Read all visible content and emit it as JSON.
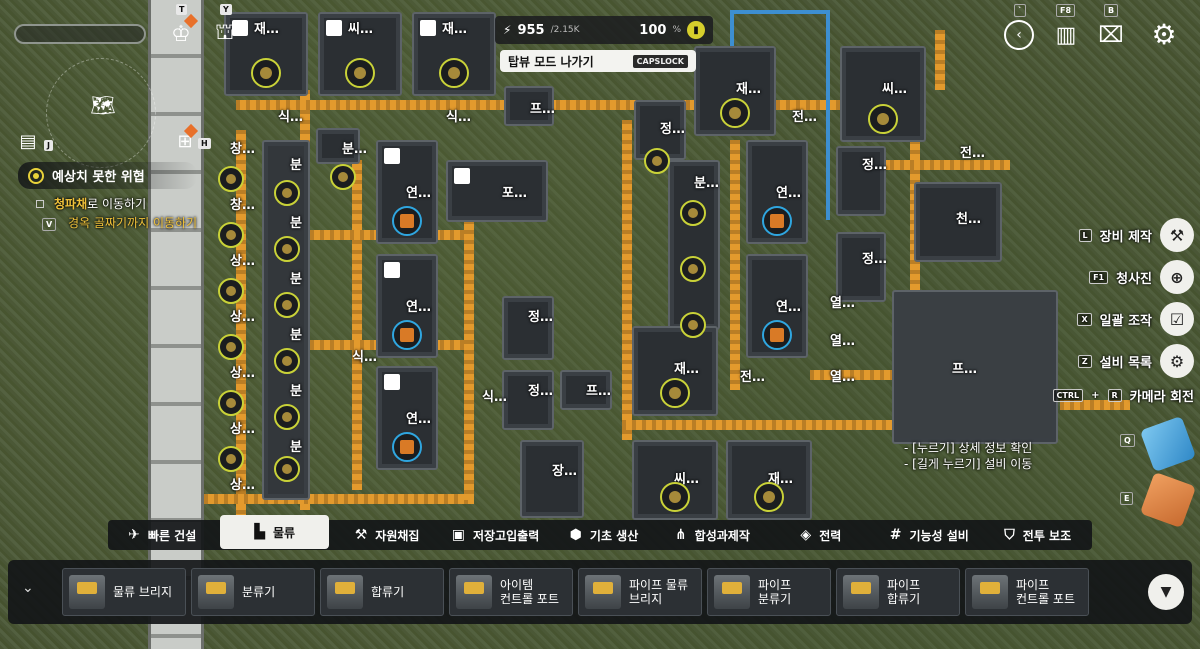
{
  "status": {
    "power": "955",
    "power_max": "/2.15K",
    "percent": "100",
    "percent_unit": "%"
  },
  "mode_button": {
    "label": "탑뷰 모드 나가기",
    "key": "CAPSLOCK"
  },
  "hud_keys": {
    "tree": "T",
    "tower": "Y",
    "info": "J",
    "bp": "H",
    "back": "`",
    "f8": "F8",
    "bag": "B"
  },
  "quest": {
    "title": "예상치 못한 위협",
    "step_highlight": "청파채",
    "step_rest": "로 이동하기",
    "step_key": "V",
    "substep": "경옥 골짜기까지 이동하기"
  },
  "right_menu": [
    {
      "key": "L",
      "label": "장비 제작",
      "icon": "equipment-craft-icon"
    },
    {
      "key": "F1",
      "label": "청사진",
      "icon": "blueprint-icon"
    },
    {
      "key": "X",
      "label": "일괄 조작",
      "icon": "batch-operation-icon"
    },
    {
      "key": "Z",
      "label": "설비 목록",
      "icon": "facility-list-icon"
    }
  ],
  "camera": {
    "key1": "CTRL",
    "key2": "R",
    "label": "카메라 회전",
    "q": "Q",
    "e": "E"
  },
  "hints": [
    "- [누르기] 상세 정보 확인",
    "- [길게 누르기] 설비 이동"
  ],
  "categories": [
    {
      "label": "빠른 건설",
      "icon": "quick-build-icon",
      "active": false
    },
    {
      "label": "물류",
      "icon": "logistics-icon",
      "active": true
    },
    {
      "label": "자원채집",
      "icon": "resource-gather-icon",
      "active": false
    },
    {
      "label": "저장고입출력",
      "icon": "storage-io-icon",
      "active": false
    },
    {
      "label": "기초 생산",
      "icon": "basic-production-icon",
      "active": false
    },
    {
      "label": "합성과제작",
      "icon": "synthesis-icon",
      "active": false
    },
    {
      "label": "전력",
      "icon": "power-icon",
      "active": false
    },
    {
      "label": "기능성 설비",
      "icon": "function-facility-icon",
      "active": false
    },
    {
      "label": "전투 보조",
      "icon": "combat-support-icon",
      "active": false
    }
  ],
  "items": [
    {
      "l1": "물류 브리지",
      "l2": ""
    },
    {
      "l1": "분류기",
      "l2": ""
    },
    {
      "l1": "합류기",
      "l2": ""
    },
    {
      "l1": "아이템",
      "l2": "컨트롤 포트"
    },
    {
      "l1": "파이프 물류",
      "l2": "브리지"
    },
    {
      "l1": "파이프",
      "l2": "분류기"
    },
    {
      "l1": "파이프",
      "l2": "합류기"
    },
    {
      "l1": "파이프",
      "l2": "컨트롤 포트"
    }
  ],
  "world_labels": {
    "jae": "재…",
    "ssi": "씨…",
    "sik": "식…",
    "bun": "분…",
    "chang": "창…",
    "sang": "상…",
    "yeon": "연…",
    "po": "포…",
    "jeong": "정…",
    "peu": "프…",
    "jeon": "전…",
    "cheon": "천…",
    "yeol": "열…",
    "jang": "장…",
    "bun2": "분"
  }
}
